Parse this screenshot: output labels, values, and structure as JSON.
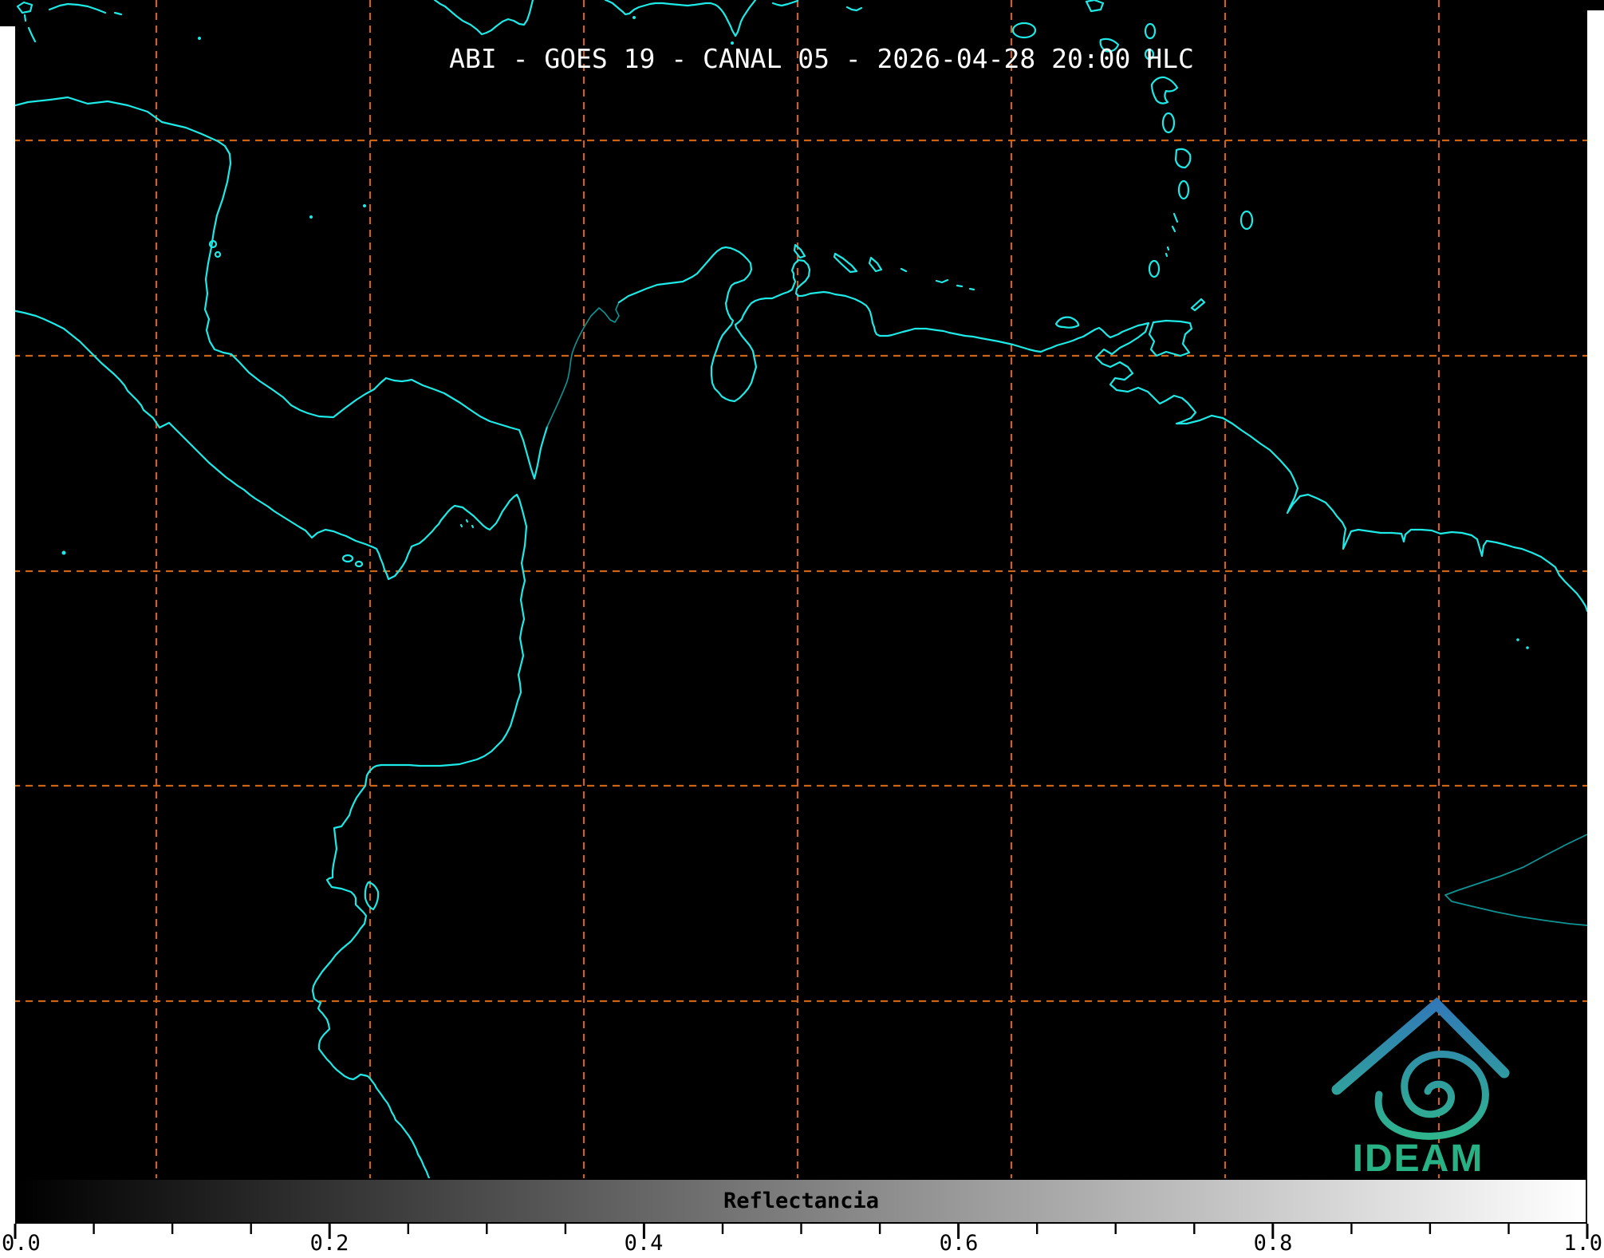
{
  "title": "ABI - GOES 19 - CANAL 05 - 2026-04-28 20:00 HLC",
  "colorbar": {
    "label": "Reflectancia",
    "tick_labels": [
      "0.0",
      "0.2",
      "0.4",
      "0.6",
      "0.8",
      "1.0"
    ],
    "range": [
      0.0,
      1.0
    ],
    "gradient_start": "#000000",
    "gradient_end": "#ffffff"
  },
  "logo": {
    "text": "IDEAM",
    "gradient_top": "#3178b8",
    "gradient_bottom": "#2fb68c",
    "text_color": "#28b185"
  },
  "map": {
    "background": "#000000",
    "coastline_color": "#1de9e6",
    "coastline_dim_color": "#0e9494",
    "gridline_color": "#cc6418",
    "scan_edge_color": "#ffffff"
  }
}
